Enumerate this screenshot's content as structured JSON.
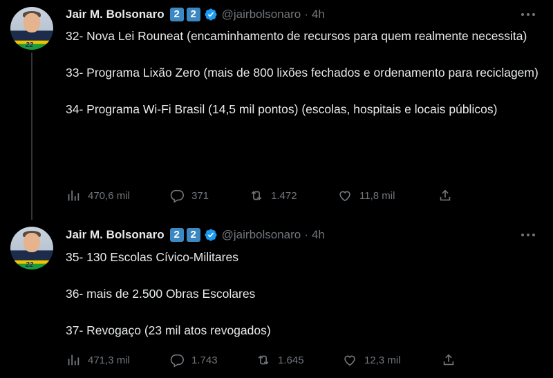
{
  "tweets": [
    {
      "name": "Jair M. Bolsonaro",
      "emoji": [
        "2",
        "2"
      ],
      "handle": "@jairbolsonaro",
      "time": "4h",
      "paragraphs": [
        "32- Nova Lei Rouneat (encaminhamento de recursos para quem realmente necessita)",
        "33- Programa Lixão Zero (mais de 800 lixões fechados e ordenamento para reciclagem)",
        "34- Programa Wi-Fi Brasil (14,5 mil pontos) (escolas, hospitais e locais públicos)"
      ],
      "stats": {
        "views": "470,6 mil",
        "replies": "371",
        "retweets": "1.472",
        "likes": "11,8 mil"
      }
    },
    {
      "name": "Jair M. Bolsonaro",
      "emoji": [
        "2",
        "2"
      ],
      "handle": "@jairbolsonaro",
      "time": "4h",
      "paragraphs": [
        "35- 130 Escolas Cívico-Militares",
        "36- mais de 2.500 Obras Escolares",
        "37- Revogaço (23 mil atos revogados)"
      ],
      "stats": {
        "views": "471,3 mil",
        "replies": "1.743",
        "retweets": "1.645",
        "likes": "12,3 mil"
      }
    }
  ],
  "avatar_text": "22",
  "icons": {
    "views": "views-bar-chart-icon",
    "reply": "reply-bubble-icon",
    "retweet": "retweet-icon",
    "like": "heart-icon",
    "share": "share-upload-icon",
    "more": "more-dots-icon",
    "verified": "verified-badge-icon"
  },
  "colors": {
    "background": "#000000",
    "text": "#e7e9ea",
    "muted": "#71767b",
    "verified": "#1d9bf0",
    "emoji_box": "#3b88c3"
  }
}
